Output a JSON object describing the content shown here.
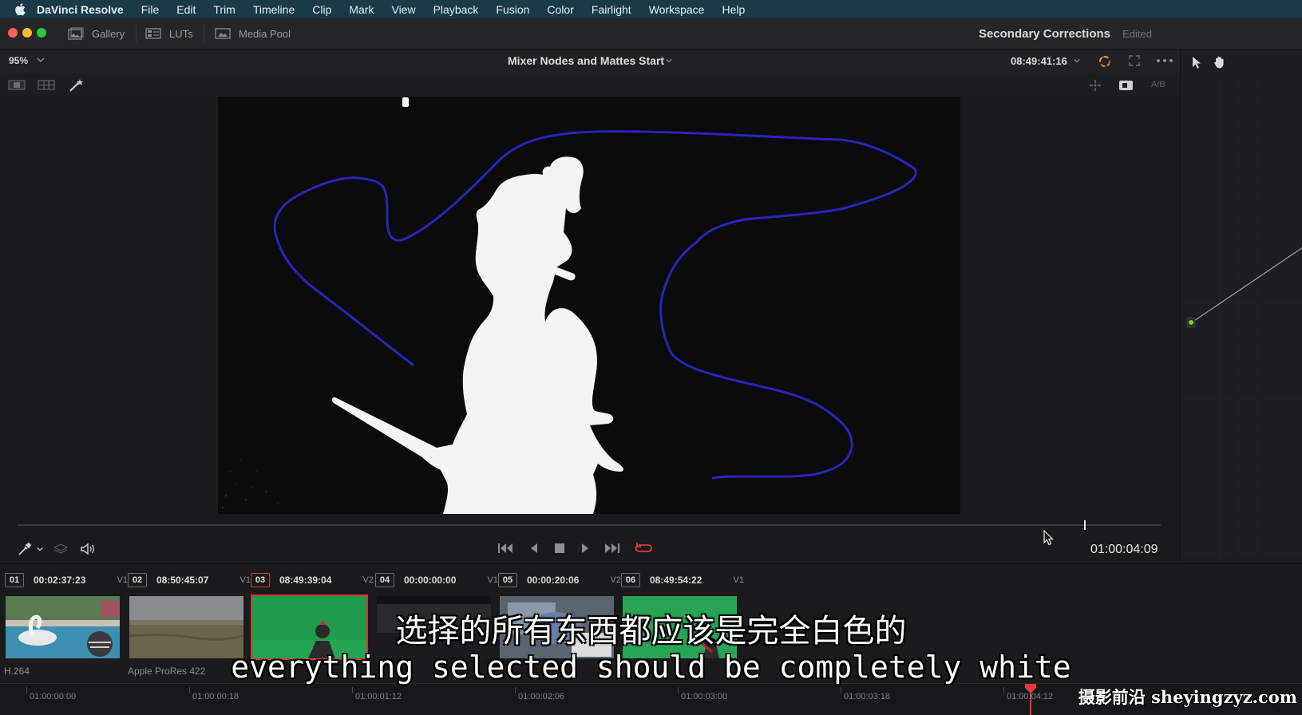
{
  "menubar": {
    "items": [
      "DaVinci Resolve",
      "File",
      "Edit",
      "Trim",
      "Timeline",
      "Clip",
      "Mark",
      "View",
      "Playback",
      "Fusion",
      "Color",
      "Fairlight",
      "Workspace",
      "Help"
    ]
  },
  "toolbar": {
    "gallery_label": "Gallery",
    "luts_label": "LUTs",
    "media_pool_label": "Media Pool",
    "project_name": "Secondary Corrections",
    "project_status": "Edited"
  },
  "viewer": {
    "zoom": "95%",
    "clip_title": "Mixer Nodes and Mattes Start",
    "timecode": "08:49:41:16",
    "ab_label": "A/B",
    "playhead_fraction": 0.933
  },
  "transport": {
    "timecode": "01:00:04:09"
  },
  "clips": [
    {
      "num": "01",
      "tc": "00:02:37:23",
      "track": "V1",
      "codec": "H.264",
      "active": false
    },
    {
      "num": "02",
      "tc": "08:50:45:07",
      "track": "V1",
      "codec": "Apple ProRes 422",
      "active": false
    },
    {
      "num": "03",
      "tc": "08:49:39:04",
      "track": "V2",
      "codec": "",
      "active": true
    },
    {
      "num": "04",
      "tc": "00:00:00:00",
      "track": "V1",
      "codec": "",
      "active": false
    },
    {
      "num": "05",
      "tc": "00:00:20:06",
      "track": "V2",
      "codec": "",
      "active": false
    },
    {
      "num": "06",
      "tc": "08:49:54:22",
      "track": "V1",
      "codec": "",
      "active": false
    }
  ],
  "mini_timeline": {
    "labels": [
      "01:00:00:00",
      "01:00:00:18",
      "01:00:01:12",
      "01:00:02:06",
      "01:00:03:00",
      "01:00:03:18",
      "01:00:04:12"
    ]
  },
  "subtitles": {
    "chinese": "选择的所有东西都应该是完全白色的",
    "english": "everything selected should be completely white"
  },
  "watermark": "摄影前沿 sheyingzyz.com",
  "colors": {
    "menubar": "#1a3a48",
    "accent_red": "#d23838",
    "stroke_blue": "#2a24b8",
    "node_green": "#7ed321"
  }
}
